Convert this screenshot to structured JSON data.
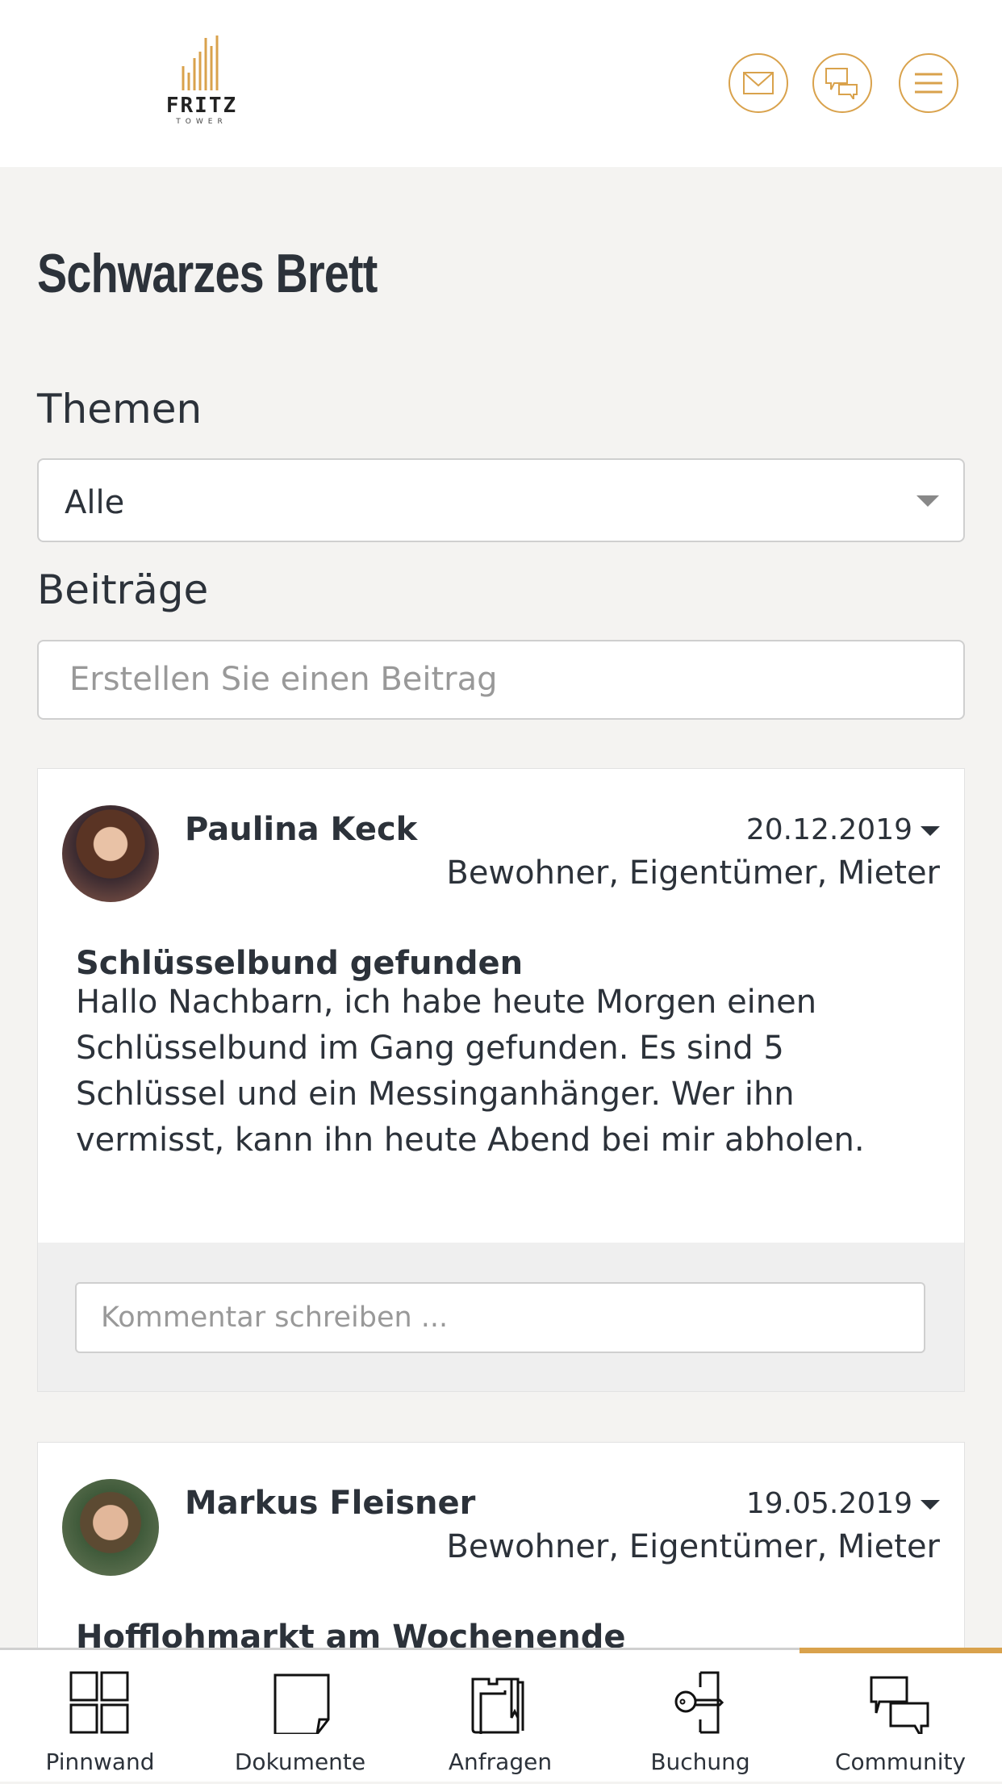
{
  "header": {
    "logo_text": "FRITZ",
    "logo_sub": "TOWER",
    "icons": [
      "mail-icon",
      "chat-icon",
      "menu-icon"
    ],
    "accent": "#d9a24c"
  },
  "page_title": "Schwarzes Brett",
  "topics": {
    "label": "Themen",
    "selected": "Alle"
  },
  "posts_section": {
    "label": "Beiträge",
    "placeholder": "Erstellen Sie einen Beitrag"
  },
  "posts": [
    {
      "author": "Paulina Keck",
      "date": "20.12.2019",
      "roles": "Bewohner, Eigentümer, Mieter",
      "title": "Schlüsselbund gefunden",
      "body": "Hallo Nachbarn, ich habe heute Morgen einen Schlüs­selbund im Gang gefunden. Es sind 5 Schlüssel und ein Messinganhänger. Wer ihn vermisst, kann ihn heute Abend bei mir abholen.",
      "comment_placeholder": "Kommentar schreiben ..."
    },
    {
      "author": "Markus Fleisner",
      "date": "19.05.2019",
      "roles": "Bewohner, Eigentümer, Mieter",
      "title": "Hofflohmarkt am Wochenende"
    }
  ],
  "nav": {
    "items": [
      {
        "label": "Pinnwand",
        "icon": "grid-icon"
      },
      {
        "label": "Dokumente",
        "icon": "document-icon"
      },
      {
        "label": "Anfragen",
        "icon": "folder-icon"
      },
      {
        "label": "Buchung",
        "icon": "key-icon"
      },
      {
        "label": "Community",
        "icon": "chat-icon"
      }
    ],
    "active": "Community"
  }
}
